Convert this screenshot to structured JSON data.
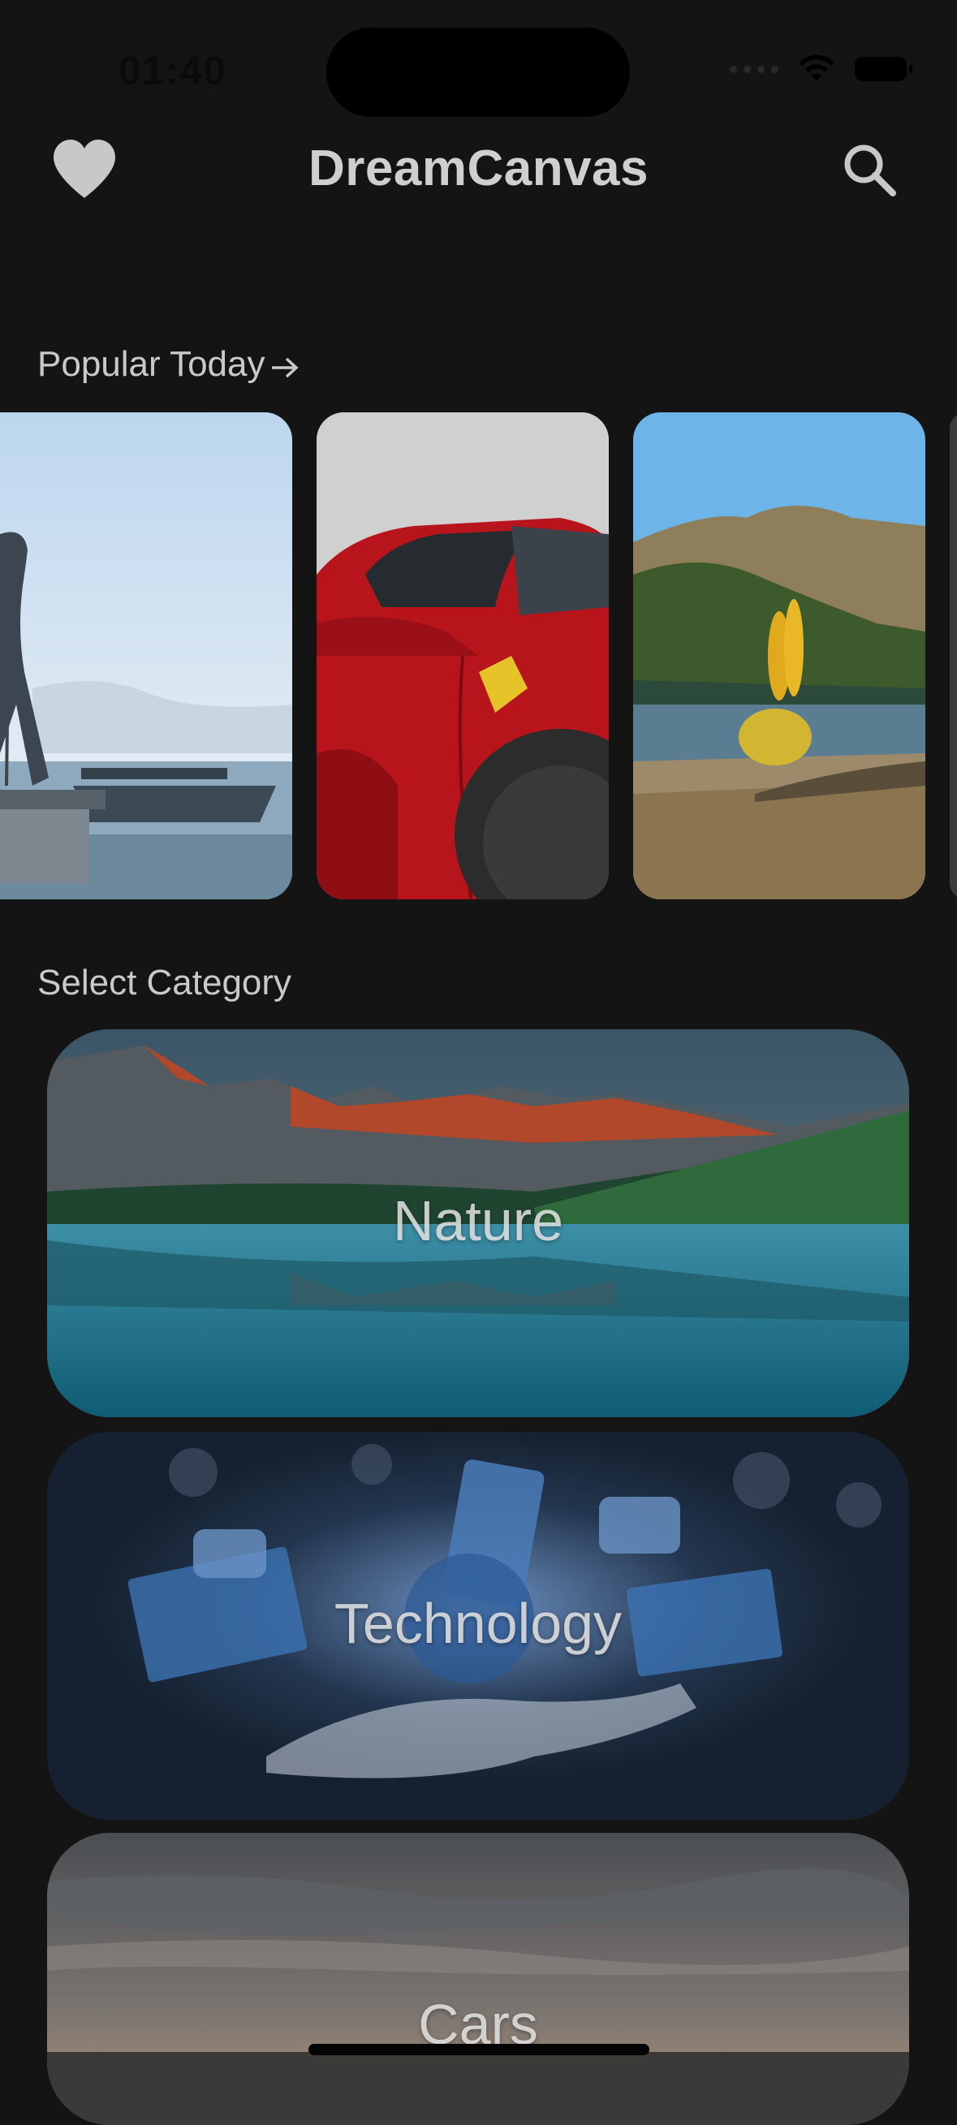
{
  "status_bar": {
    "time": "01:40"
  },
  "header": {
    "title": "DreamCanvas",
    "favorites_icon": "heart-icon",
    "search_icon": "search-icon"
  },
  "popular": {
    "title": "Popular Today",
    "arrow_icon": "arrow-right-icon"
  },
  "categories": {
    "title": "Select Category",
    "items": [
      {
        "label": "Nature"
      },
      {
        "label": "Technology"
      },
      {
        "label": "Cars"
      }
    ]
  },
  "colors": {
    "background": "#141414",
    "text": "#d9d9d9"
  }
}
